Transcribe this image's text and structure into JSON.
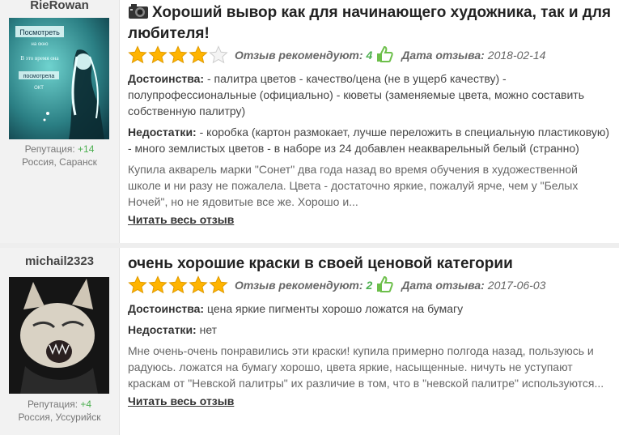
{
  "reviews": [
    {
      "username": "RieRowan",
      "reputation_label": "Репутация:",
      "reputation_value": "+14",
      "location": "Россия, Саранск",
      "title": "Хороший вывор как для начинающего художника, так и для любителя!",
      "rating": 4,
      "recommend_label": "Отзыв рекомендуют:",
      "recommend_count": "4",
      "date_label": "Дата отзыва:",
      "date": "2018-02-14",
      "pros_label": "Достоинства:",
      "pros": " - палитра цветов - качество/цена (не в ущерб качеству) - полупрофессиональные (официально) - кюветы (заменяемые цвета, можно составить собственную палитру)",
      "cons_label": "Недостатки:",
      "cons": " - коробка (картон размокает, лучше переложить в специальную пластиковую) - много землистых цветов - в наборе из 24 добавлен неакварельный белый (странно)",
      "text": "Купила акварель марки \"Сонет\" два года назад во время обучения в художественной школе и ни разу не пожалела. Цвета - достаточно яркие, пожалуй ярче, чем у \"Белых Ночей\", но не ядовитые все же. Хорошо и...",
      "read_more": "Читать весь отзыв"
    },
    {
      "username": "michail2323",
      "reputation_label": "Репутация:",
      "reputation_value": "+4",
      "location": "Россия, Уссурийск",
      "title": "очень хорошие краски в своей ценовой категории",
      "rating": 5,
      "recommend_label": "Отзыв рекомендуют:",
      "recommend_count": "2",
      "date_label": "Дата отзыва:",
      "date": "2017-06-03",
      "pros_label": "Достоинства:",
      "pros": " цена яркие пигменты хорошо ложатся на бумагу",
      "cons_label": "Недостатки:",
      "cons": " нет",
      "text": "Мне очень-очень понравились эти краски! купила примерно полгода назад, пользуюсь и радуюсь. ложатся на бумагу хорошо, цвета яркие, насыщенные. ничуть не уступают краскам от \"Невской палитры\" их различие в том, что в \"невской палитре\" используются...",
      "read_more": "Читать весь отзыв"
    }
  ],
  "avatar1": {
    "text_line1": "Посмотреть",
    "text_line2": "на окно",
    "text_line3": "В это время она",
    "text_line4": "посмотрела",
    "text_line5": "ОКТ"
  },
  "icons": {
    "camera": "camera-icon",
    "star": "star-icon",
    "thumb": "thumbs-up-icon"
  },
  "colors": {
    "star": "#ffb400",
    "star_empty": "#cccccc",
    "green": "#4caf50"
  }
}
